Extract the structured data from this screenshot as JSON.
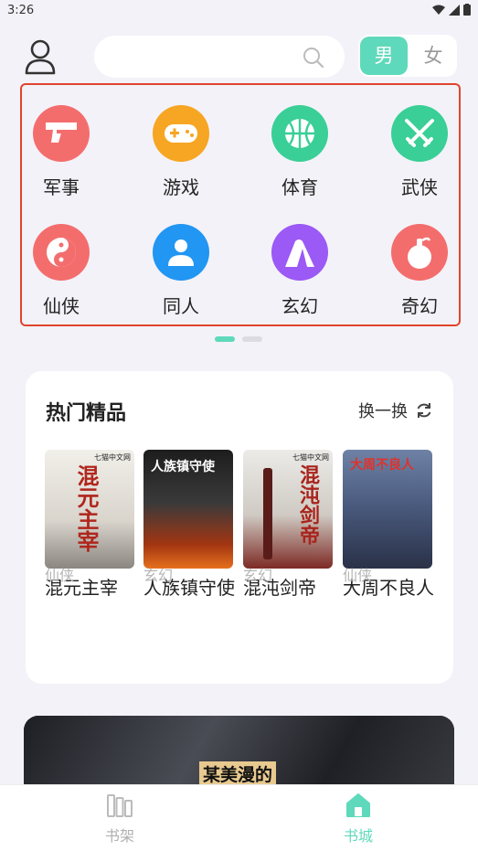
{
  "status": {
    "time": "3:26"
  },
  "gender": {
    "male": "男",
    "female": "女"
  },
  "categories": [
    {
      "label": "军事",
      "color": "#f46d6d",
      "icon": "gun-icon"
    },
    {
      "label": "游戏",
      "color": "#f6a623",
      "icon": "gamepad-icon"
    },
    {
      "label": "体育",
      "color": "#39cf96",
      "icon": "basketball-icon"
    },
    {
      "label": "武侠",
      "color": "#39cf96",
      "icon": "swords-icon"
    },
    {
      "label": "仙侠",
      "color": "#f46d6d",
      "icon": "yinyang-icon"
    },
    {
      "label": "同人",
      "color": "#2196f3",
      "icon": "person-icon"
    },
    {
      "label": "玄幻",
      "color": "#9b59f5",
      "icon": "mountain-icon"
    },
    {
      "label": "奇幻",
      "color": "#f46d6d",
      "icon": "gourd-icon"
    }
  ],
  "hot": {
    "title": "热门精品",
    "refresh_label": "换一换",
    "books": [
      {
        "title": "混元主宰",
        "genre": "仙侠",
        "cover_text": "混元主宰",
        "cover_tag": "七猫中文网"
      },
      {
        "title": "人族镇守使",
        "genre": "玄幻",
        "cover_text": "人族镇守使",
        "cover_tag": ""
      },
      {
        "title": "混沌剑帝",
        "genre": "玄幻",
        "cover_text": "混沌剑帝",
        "cover_tag": "七猫中文网"
      },
      {
        "title": "大周不良人",
        "genre": "仙侠",
        "cover_text": "大周不良人",
        "cover_tag": ""
      }
    ]
  },
  "banner": {
    "text": "某美漫的"
  },
  "tabs": {
    "bookshelf": "书架",
    "bookstore": "书城"
  },
  "colors": {
    "accent": "#5fd9bb"
  }
}
